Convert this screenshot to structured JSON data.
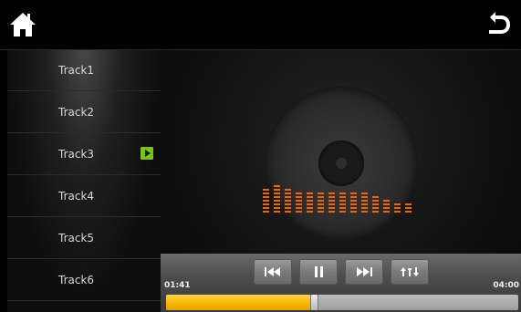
{
  "header": {
    "home_icon": "home-icon",
    "back_icon": "back-arrow-icon"
  },
  "sidebar": {
    "items": [
      {
        "label": "Track1",
        "playing": false
      },
      {
        "label": "Track2",
        "playing": false
      },
      {
        "label": "Track3",
        "playing": true
      },
      {
        "label": "Track4",
        "playing": false
      },
      {
        "label": "Track5",
        "playing": false
      },
      {
        "label": "Track6",
        "playing": false
      }
    ],
    "playing_indicator_color": "#7bc11f"
  },
  "player": {
    "elapsed": "01:41",
    "total": "04:00",
    "progress_fraction": 0.42,
    "accent_color": "#f7b500",
    "eq_color": "#e8651a",
    "controls": [
      {
        "name": "previous-button",
        "icon": "previous-icon"
      },
      {
        "name": "pause-button",
        "icon": "pause-icon"
      },
      {
        "name": "next-button",
        "icon": "next-icon"
      },
      {
        "name": "playlist-mode-button",
        "icon": "shuffle-sort-icon"
      }
    ]
  }
}
